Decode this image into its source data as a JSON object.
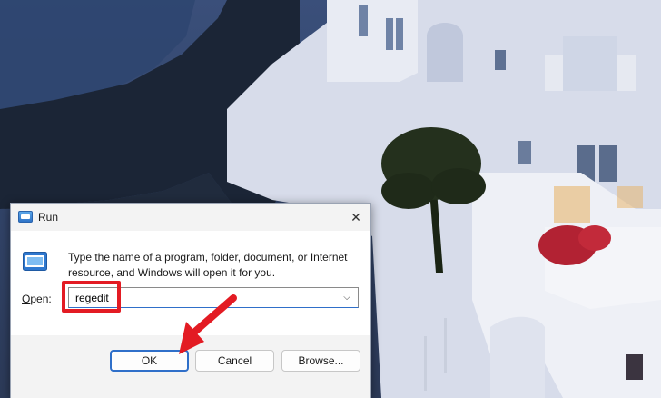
{
  "dialog": {
    "title": "Run",
    "close_glyph": "✕",
    "instructions": "Type the name of a program, folder, document, or Internet resource, and Windows will open it for you.",
    "open_label_mnemonic": "O",
    "open_label_rest": "pen:",
    "open_value": "regedit",
    "dropdown_glyph": "⌵",
    "buttons": {
      "ok": "OK",
      "cancel": "Cancel",
      "browse": "Browse..."
    },
    "icons": {
      "title": "run-icon",
      "app": "run-app-icon",
      "close": "close-icon",
      "dropdown": "chevron-down-icon"
    }
  },
  "annotation": {
    "color": "#e31b23",
    "highlight": "regedit input box",
    "arrow_target": "OK button"
  },
  "colors": {
    "accent": "#2f6fc9",
    "annotation_red": "#e31b23",
    "dialog_bg": "#f3f3f3"
  }
}
